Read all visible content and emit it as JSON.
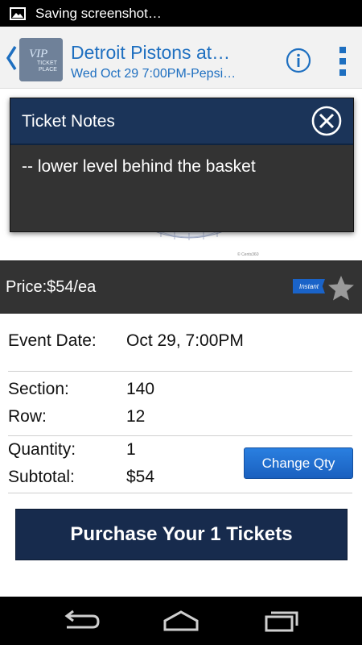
{
  "status_bar": {
    "text": "Saving screenshot…"
  },
  "header": {
    "title": "Detroit Pistons at…",
    "subtitle": "Wed Oct 29  7:00PM-Pepsi…",
    "logo_text": "VIP TICKET PLACE"
  },
  "map": {
    "copyright": "© Cents360"
  },
  "dialog": {
    "title": "Ticket Notes",
    "body": "-- lower level behind the basket"
  },
  "price": {
    "text": "Price:$54/ea",
    "badge": "Instant"
  },
  "details": {
    "event_date_label": "Event Date:",
    "event_date_value": "Oct 29, 7:00PM",
    "section_label": "Section:",
    "section_value": "140",
    "row_label": "Row:",
    "row_value": "12",
    "quantity_label": "Quantity:",
    "quantity_value": "1",
    "subtotal_label": "Subtotal:",
    "subtotal_value": "$54"
  },
  "buttons": {
    "change_qty": "Change Qty",
    "purchase": "Purchase Your 1 Tickets"
  },
  "colors": {
    "accent": "#1e6fc0",
    "dialog_header": "#1b3459",
    "purchase_button": "#172b4d",
    "change_button": "#1a60bf"
  }
}
